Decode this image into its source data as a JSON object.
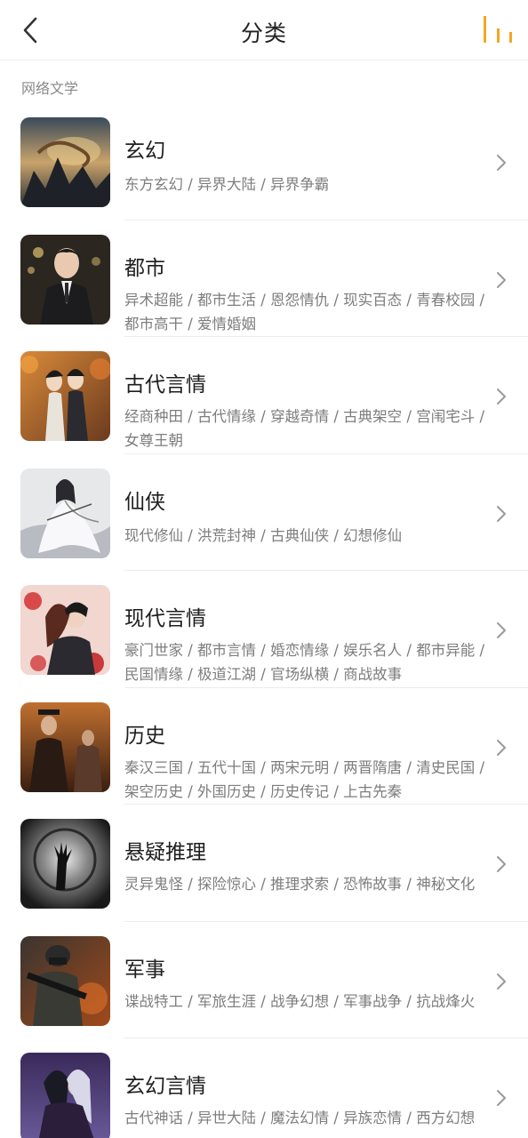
{
  "header": {
    "title": "分类",
    "back_icon": "chevron-left-icon",
    "rank_icon": "bar-chart-icon",
    "accent_color": "#F5A623"
  },
  "section": {
    "label": "网络文学"
  },
  "categories": [
    {
      "title": "玄幻",
      "tags": "东方玄幻 / 异界大陆 / 异界争霸",
      "cover": "dragon-over-mountains-cover"
    },
    {
      "title": "都市",
      "tags": "异术超能 / 都市生活 / 恩怨情仇 / 现实百态 / 青春校园 / 都市高干 / 爱情婚姻",
      "cover": "man-in-suit-cover"
    },
    {
      "title": "古代言情",
      "tags": "经商种田 / 古代情缘 / 穿越奇情 / 古典架空 / 宫闱宅斗 / 女尊王朝",
      "cover": "ancient-couple-cover"
    },
    {
      "title": "仙侠",
      "tags": "现代修仙 / 洪荒封神 / 古典仙侠 / 幻想修仙",
      "cover": "white-robed-immortal-cover"
    },
    {
      "title": "现代言情",
      "tags": "豪门世家 / 都市言情 / 婚恋情缘 / 娱乐名人 / 都市异能 / 民国情缘 / 极道江湖 / 官场纵横 / 商战故事",
      "cover": "modern-couple-roses-cover"
    },
    {
      "title": "历史",
      "tags": "秦汉三国 / 五代十国 / 两宋元明 / 两晋隋唐 / 清史民国 / 架空历史 / 外国历史 / 历史传记 / 上古先秦",
      "cover": "emperor-warrior-cover"
    },
    {
      "title": "悬疑推理",
      "tags": "灵异鬼怪 / 探险惊心 / 推理求索 / 恐怖故事 / 神秘文化",
      "cover": "reaching-hand-tunnel-cover"
    },
    {
      "title": "军事",
      "tags": "谍战特工 / 军旅生涯 / 战争幻想 / 军事战争 / 抗战烽火",
      "cover": "armed-soldier-cover"
    },
    {
      "title": "玄幻言情",
      "tags": "古代神话 / 异世大陆 / 魔法幻情 / 异族恋情 / 西方幻想",
      "cover": "dark-fantasy-couple-cover"
    }
  ]
}
